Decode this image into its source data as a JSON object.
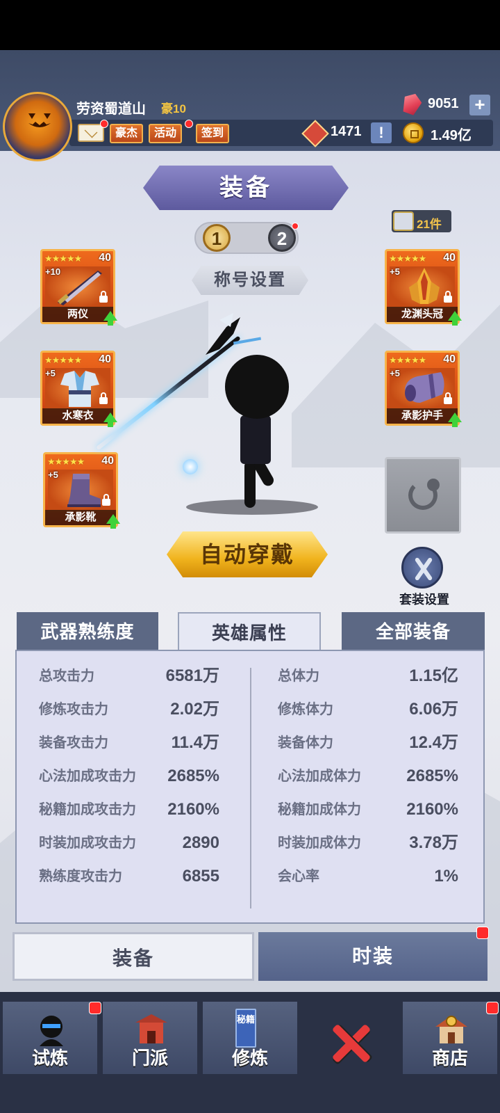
{
  "player": {
    "name": "劳资蜀道山",
    "vip": "豪10",
    "gems": "9051",
    "honor": "1471",
    "gold": "1.49亿"
  },
  "header_buttons": {
    "hero": "豪杰",
    "event": "活动",
    "checkin": "签到"
  },
  "icons": {
    "plus": "+",
    "excl": "!"
  },
  "equip_page": {
    "title": "装备",
    "loadout_1": "1",
    "loadout_2": "2",
    "item_count": "21件",
    "title_setting": "称号设置",
    "auto_equip": "自动穿戴",
    "suit_setting": "套装设置"
  },
  "equipment": [
    {
      "name": "两仪",
      "level": "40",
      "plus": "+10",
      "stars": "★★★★★",
      "slot": "weapon"
    },
    {
      "name": "水寒衣",
      "level": "40",
      "plus": "+5",
      "stars": "★★★★★",
      "slot": "armor"
    },
    {
      "name": "承影靴",
      "level": "40",
      "plus": "+5",
      "stars": "★★★★★",
      "slot": "boots"
    },
    {
      "name": "龙渊头冠",
      "level": "40",
      "plus": "+5",
      "stars": "★★★★★",
      "slot": "helmet"
    },
    {
      "name": "承影护手",
      "level": "40",
      "plus": "+5",
      "stars": "★★★★★",
      "slot": "gloves"
    }
  ],
  "stat_tabs": {
    "weapon_mastery": "武器熟练度",
    "hero_attributes": "英雄属性",
    "all_equipment": "全部装备"
  },
  "stats_left": [
    {
      "label": "总攻击力",
      "value": "6581万"
    },
    {
      "label": "修炼攻击力",
      "value": "2.02万"
    },
    {
      "label": "装备攻击力",
      "value": "11.4万"
    },
    {
      "label": "心法加成攻击力",
      "value": "2685%"
    },
    {
      "label": "秘籍加成攻击力",
      "value": "2160%"
    },
    {
      "label": "时装加成攻击力",
      "value": "2890"
    },
    {
      "label": "熟练度攻击力",
      "value": "6855"
    }
  ],
  "stats_right": [
    {
      "label": "总体力",
      "value": "1.15亿"
    },
    {
      "label": "修炼体力",
      "value": "6.06万"
    },
    {
      "label": "装备体力",
      "value": "12.4万"
    },
    {
      "label": "心法加成体力",
      "value": "2685%"
    },
    {
      "label": "秘籍加成体力",
      "value": "2160%"
    },
    {
      "label": "时装加成体力",
      "value": "3.78万"
    },
    {
      "label": "会心率",
      "value": "1%"
    }
  ],
  "bottom_tabs": {
    "equipment": "装备",
    "fashion": "时装"
  },
  "nav": {
    "trial": "试炼",
    "sect": "门派",
    "cultivate": "修炼",
    "cultivate_book": "秘籍",
    "shop": "商店"
  },
  "colors": {
    "accent_orange": "#ef6a1d",
    "gold": "#f0b31d",
    "panel": "#dfe0f2",
    "nav": "#2a3145",
    "badge_red": "#ff2b2b"
  }
}
